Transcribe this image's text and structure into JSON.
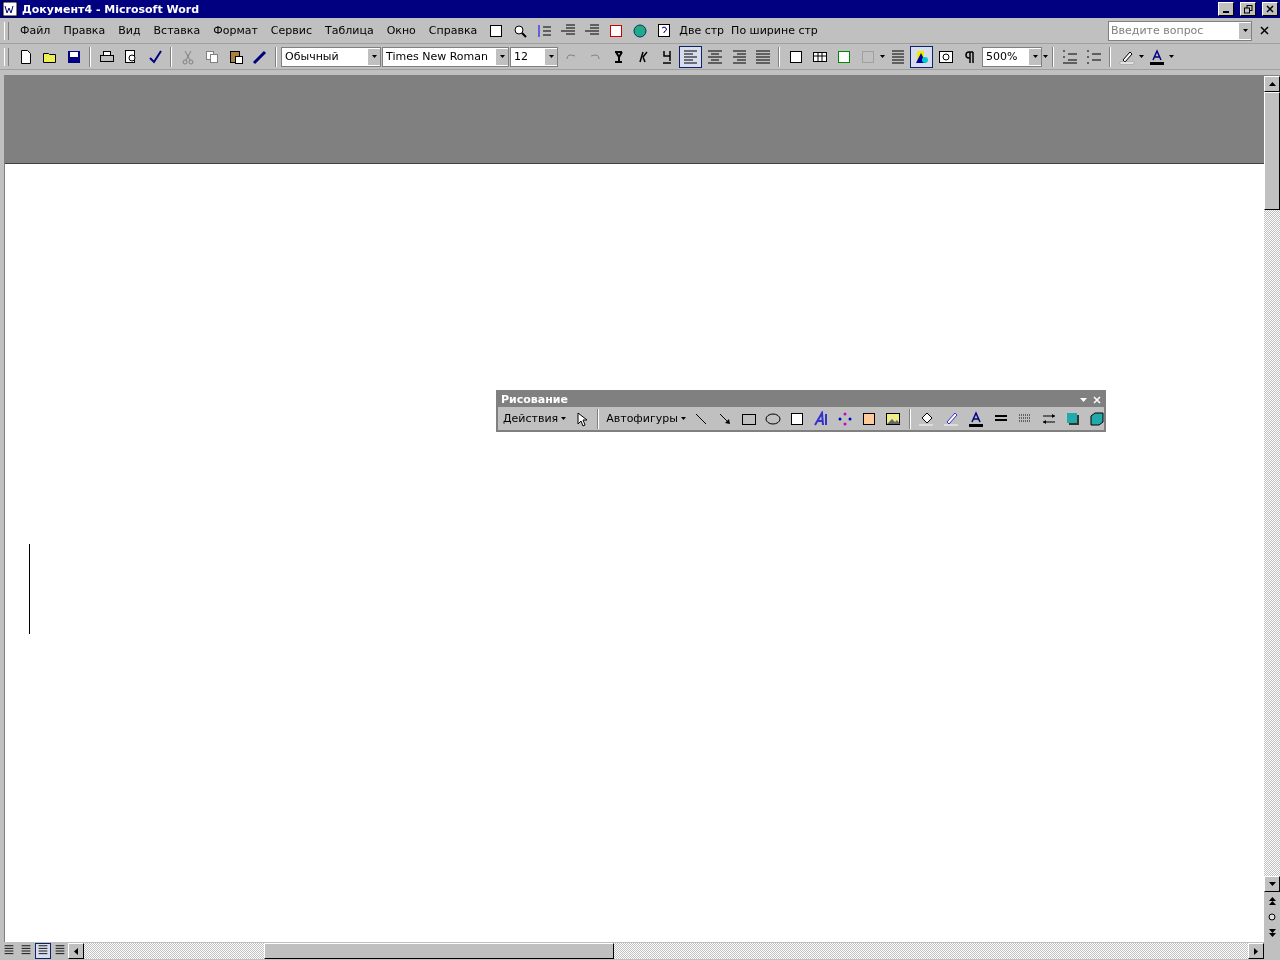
{
  "window": {
    "title": "Документ4 - Microsoft Word"
  },
  "menu": [
    {
      "label": "Файл"
    },
    {
      "label": "Правка"
    },
    {
      "label": "Вид"
    },
    {
      "label": "Вставка"
    },
    {
      "label": "Формат"
    },
    {
      "label": "Сервис"
    },
    {
      "label": "Таблица"
    },
    {
      "label": "Окно"
    },
    {
      "label": "Справка"
    }
  ],
  "menu_toolbar": {
    "text_buttons": [
      "Две стр",
      "По ширине стр"
    ]
  },
  "help_search": {
    "placeholder": "Введите вопрос"
  },
  "formatting": {
    "style": "Обычный",
    "font": "Times New Roman",
    "size": "12",
    "zoom": "500%",
    "align": [
      {
        "selected": true
      },
      {
        "selected": false
      },
      {
        "selected": false
      },
      {
        "selected": false
      }
    ],
    "drawing_toggle": {
      "selected": true
    }
  },
  "drawing_toolbar": {
    "title": "Рисование",
    "actions": "Действия",
    "autoshapes": "Автофигуры"
  },
  "view_buttons": [
    {
      "selected": false
    },
    {
      "selected": false
    },
    {
      "selected": true
    },
    {
      "selected": false
    }
  ]
}
